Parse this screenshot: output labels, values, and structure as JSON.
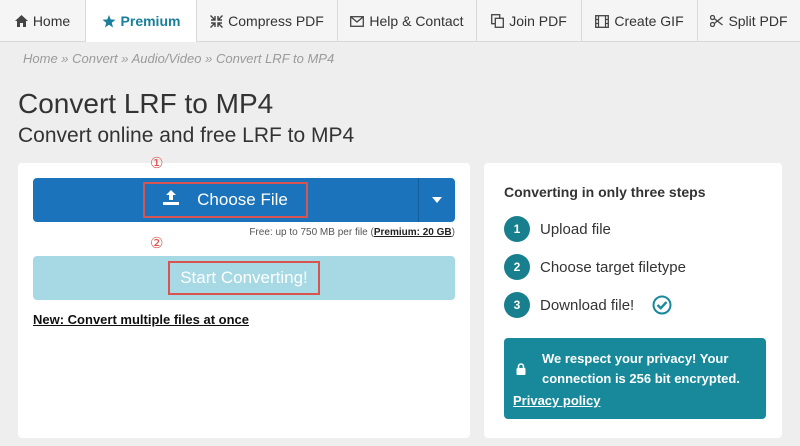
{
  "nav": {
    "items": [
      {
        "label": "Home",
        "icon": "home-icon"
      },
      {
        "label": "Premium",
        "icon": "star-icon",
        "active": true
      },
      {
        "label": "Compress PDF",
        "icon": "compress-icon"
      },
      {
        "label": "Help & Contact",
        "icon": "envelope-icon"
      },
      {
        "label": "Join PDF",
        "icon": "copy-icon"
      },
      {
        "label": "Create GIF",
        "icon": "film-icon"
      },
      {
        "label": "Split PDF",
        "icon": "scissors-icon"
      }
    ]
  },
  "breadcrumb": "Home » Convert » Audio/Video » Convert LRF to MP4",
  "page": {
    "title": "Convert LRF to MP4",
    "subtitle": "Convert online and free LRF to MP4"
  },
  "upload": {
    "marker1": "①",
    "marker2": "②",
    "choose_label": "Choose File",
    "limit_text": "Free: up to 750 MB per file (",
    "limit_premium": "Premium: 20 GB",
    "limit_close": ")",
    "start_label": "Start Converting!",
    "multi_link": "New: Convert multiple files at once"
  },
  "steps": {
    "title": "Converting in only three steps",
    "items": [
      {
        "num": "1",
        "label": "Upload file"
      },
      {
        "num": "2",
        "label": "Choose target filetype"
      },
      {
        "num": "3",
        "label": "Download file!"
      }
    ]
  },
  "privacy": {
    "text": "We respect your privacy! Your connection is 256 bit encrypted.",
    "link": "Privacy policy"
  },
  "colors": {
    "brand_blue": "#1a73bb",
    "teal": "#17899a",
    "start_button": "#a6d9e3",
    "annotation_red": "#d9534f"
  }
}
